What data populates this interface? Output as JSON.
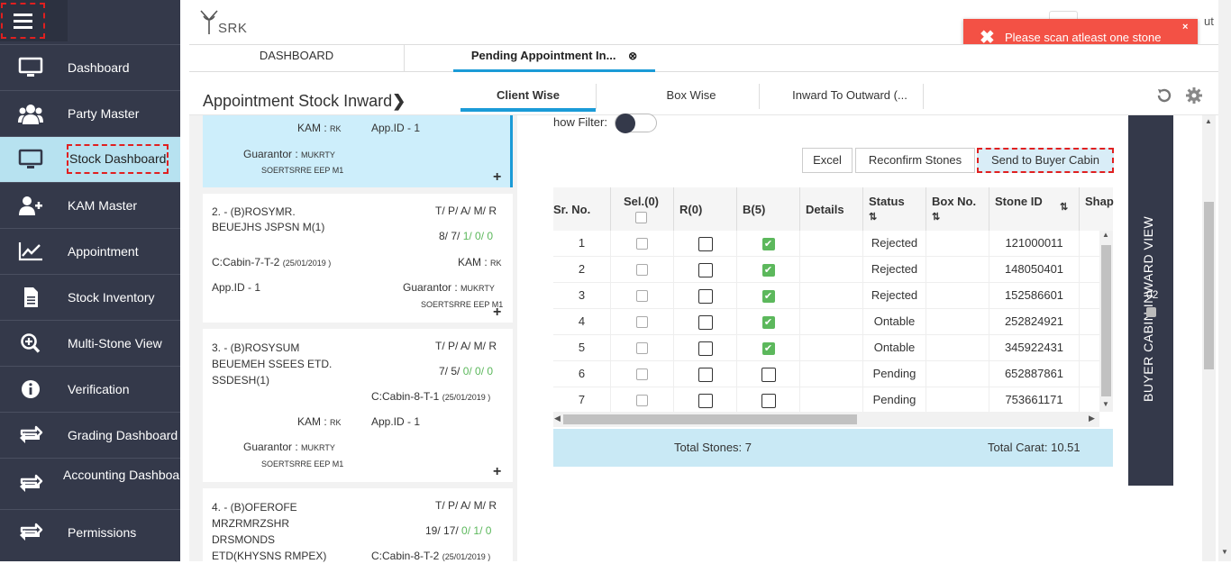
{
  "sidebar": {
    "items": [
      {
        "label": "Dashboard",
        "icon": "monitor-icon"
      },
      {
        "label": "Party Master",
        "icon": "users-icon"
      },
      {
        "label": "Stock Dashboard",
        "icon": "monitor-icon"
      },
      {
        "label": "KAM Master",
        "icon": "user-plus-icon"
      },
      {
        "label": "Appointment",
        "icon": "chart-line-icon"
      },
      {
        "label": "Stock Inventory",
        "icon": "document-icon"
      },
      {
        "label": "Multi-Stone View",
        "icon": "zoom-in-icon"
      },
      {
        "label": "Verification",
        "icon": "info-icon"
      },
      {
        "label": "Grading Dashboard",
        "icon": "exchange-icon"
      },
      {
        "label": "Accounting Dashboard",
        "icon": "exchange-icon"
      },
      {
        "label": "Permissions",
        "icon": "exchange-icon"
      }
    ]
  },
  "header": {
    "logo_text": "SRK",
    "signout_partial": "ut"
  },
  "toast": {
    "message": "Please scan atleast one stone",
    "icon": "close-icon",
    "close": "×"
  },
  "tabs": [
    {
      "label": "DASHBOARD"
    },
    {
      "label": "Pending Appointment In...",
      "close": "⊗"
    }
  ],
  "section": {
    "title": "Appointment Stock Inward",
    "chevron": "❯",
    "subtabs": [
      "Client Wise",
      "Box Wise",
      "Inward To Outward (..."
    ]
  },
  "cards": [
    {
      "kam_label": "KAM :",
      "kam_val": "RK",
      "appid": "App.ID - 1",
      "guar_label": "Guarantor :",
      "guar_val": "MUKRTY",
      "guar_sub": "SOERTSRRE EEP M1",
      "plus": "+"
    },
    {
      "title": "2. - (B)ROSYMR. BEUEJHS JSPSN M(1)",
      "tpamr": "T/ P/ A/ M/ R",
      "c1": "8/ 7/ ",
      "c2": "1",
      "c3": "/ ",
      "c4": "0",
      "c5": "/ ",
      "c6": "0",
      "cabin": "C:Cabin-7-T-2",
      "date": "(25/01/2019 )",
      "kam_label": "KAM :",
      "kam_val": "RK",
      "appid": "App.ID - 1",
      "guar_label": "Guarantor :",
      "guar_val": "MUKRTY",
      "guar_sub": "SOERTSRRE EEP M1",
      "plus": "+"
    },
    {
      "title": "3. - (B)ROSYSUM BEUEMEH SSEES ETD. SSDESH(1)",
      "tpamr": "T/ P/ A/ M/ R",
      "c1": "7/ 5/ ",
      "c2": "0",
      "c3": "/ ",
      "c4": "0",
      "c5": "/ ",
      "c6": "0",
      "cabin": "C:Cabin-8-T-1",
      "date": "(25/01/2019 )",
      "kam_label": "KAM :",
      "kam_val": "RK",
      "appid": "App.ID - 1",
      "guar_label": "Guarantor :",
      "guar_val": "MUKRTY",
      "guar_sub": "SOERTSRRE EEP M1",
      "plus": "+"
    },
    {
      "title": "4. - (B)OFEROFE MRZRMRZSHR DRSMONDS ETD(KHYSNS RMPEX)",
      "tpamr": "T/ P/ A/ M/ R",
      "c1": "19/ 17/ ",
      "c2": "0",
      "c3": "/ ",
      "c4": "1",
      "c5": "/ ",
      "c6": "0",
      "cabin": "C:Cabin-8-T-2",
      "date": "(25/01/2019 )"
    }
  ],
  "filter": {
    "label": "how Filter:"
  },
  "buttons": {
    "excel": "Excel",
    "reconfirm": "Reconfirm Stones",
    "send": "Send to Buyer Cabin"
  },
  "table": {
    "headers": [
      "Sr. No.",
      "Sel.(0)",
      "R(0)",
      "B(5)",
      "Details",
      "Status",
      "Box No.",
      "Stone ID",
      "Shap"
    ],
    "rows": [
      {
        "sr": "1",
        "b": true,
        "status": "Rejected",
        "stone": "121000011"
      },
      {
        "sr": "2",
        "b": true,
        "status": "Rejected",
        "stone": "148050401"
      },
      {
        "sr": "3",
        "b": true,
        "status": "Rejected",
        "stone": "152586601"
      },
      {
        "sr": "4",
        "b": true,
        "status": "Ontable",
        "stone": "252824921"
      },
      {
        "sr": "5",
        "b": true,
        "status": "Ontable",
        "stone": "345922431"
      },
      {
        "sr": "6",
        "b": false,
        "status": "Pending",
        "stone": "652887861"
      },
      {
        "sr": "7",
        "b": false,
        "status": "Pending",
        "stone": "753661171"
      }
    ]
  },
  "totals": {
    "stones": "Total Stones: 7",
    "carat": "Total Carat: 10.51"
  },
  "buyer_panel": {
    "title": "BUYER CABIN INWARD VIEW",
    "count": "02"
  },
  "colors": {
    "sidebar": "#34394a",
    "accent": "#1b9bd7",
    "toast": "#f35145",
    "active": "#b7e2f0"
  }
}
